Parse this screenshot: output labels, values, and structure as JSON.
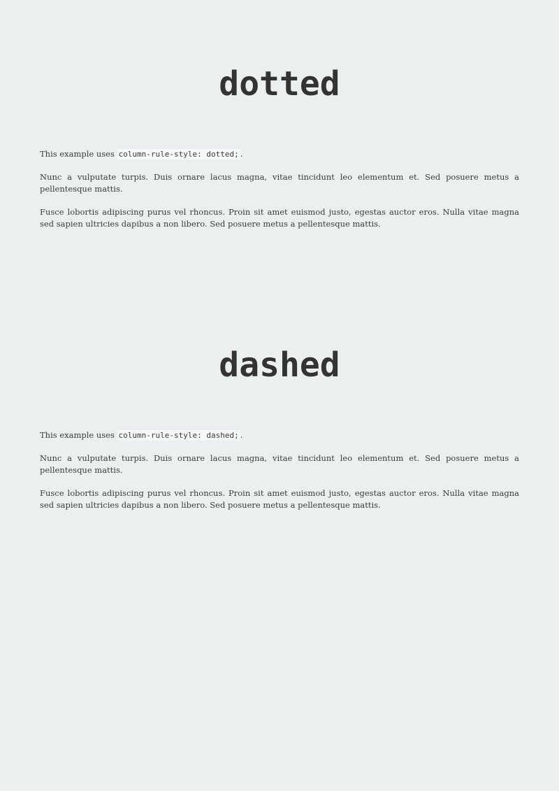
{
  "sections": [
    {
      "title": "dotted",
      "intro_prefix": "This example uses ",
      "intro_code": "column-rule-style: dotted;",
      "intro_suffix": ".",
      "paragraphs": [
        "Nunc a vulputate turpis. Duis ornare lacus magna, vitae tincidunt leo elementum et. Sed posuere metus a pellentesque mattis.",
        "Fusce lobortis adipiscing purus vel rhoncus. Proin sit amet euismod justo, egestas auctor eros. Nulla vitae magna sed sapien ultricies dapibus a non libero. Sed posuere metus a pellentesque mattis."
      ]
    },
    {
      "title": "dashed",
      "intro_prefix": "This example uses ",
      "intro_code": "column-rule-style: dashed;",
      "intro_suffix": ".",
      "paragraphs": [
        "Nunc a vulputate turpis. Duis ornare lacus magna, vitae tincidunt leo elementum et. Sed posuere metus a pellentesque mattis.",
        "Fusce lobortis adipiscing purus vel rhoncus. Proin sit amet euismod justo, egestas auctor eros. Nulla vitae magna sed sapien ultricies dapibus a non libero. Sed posuere metus a pellentesque mattis."
      ]
    }
  ]
}
